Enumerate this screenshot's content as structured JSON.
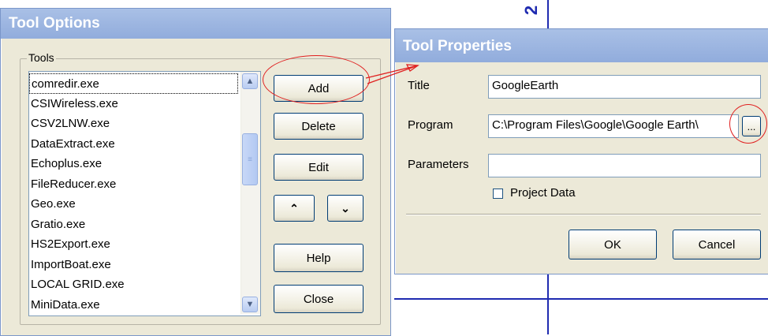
{
  "background": {
    "digit": "2"
  },
  "tool_options": {
    "title": "Tool Options",
    "group_label": "Tools",
    "items": [
      "comredir.exe",
      "CSIWireless.exe",
      "CSV2LNW.exe",
      "DataExtract.exe",
      "Echoplus.exe",
      "FileReducer.exe",
      "Geo.exe",
      "Gratio.exe",
      "HS2Export.exe",
      "ImportBoat.exe",
      "LOCAL GRID.exe",
      "MiniData.exe"
    ],
    "buttons": {
      "add": "Add",
      "delete": "Delete",
      "edit": "Edit",
      "move_up": "^",
      "move_down": "v",
      "help": "Help",
      "close": "Close"
    }
  },
  "tool_properties": {
    "title": "Tool Properties",
    "title_label": "Title",
    "title_value": "GoogleEarth",
    "program_label": "Program",
    "program_value": "C:\\Program Files\\Google\\Google Earth\\",
    "browse_label": "...",
    "parameters_label": "Parameters",
    "parameters_value": "",
    "project_data_label": "Project Data",
    "project_data_checked": false,
    "ok_label": "OK",
    "cancel_label": "Cancel"
  },
  "colors": {
    "titlebar": "#91acdc",
    "annotation": "#e02020",
    "background_lines": "#1f2bb0"
  }
}
